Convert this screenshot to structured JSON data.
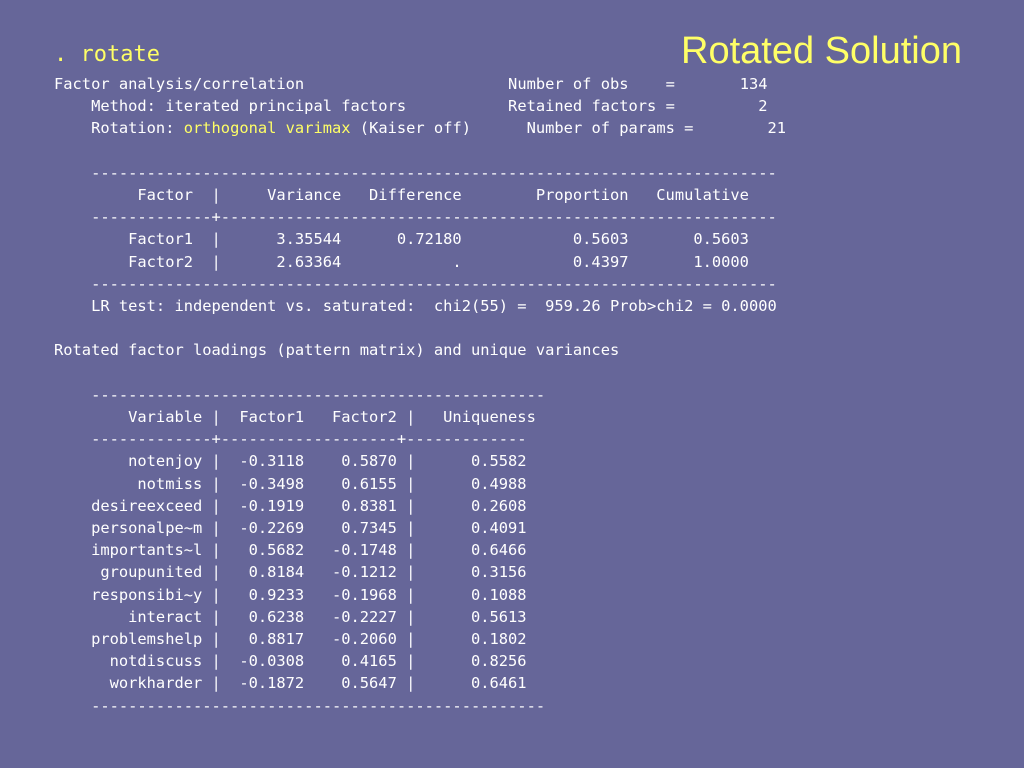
{
  "slide": {
    "title": "Rotated Solution",
    "command": ". rotate"
  },
  "colors": {
    "background": "#666699",
    "text": "#ffffff",
    "highlight": "#ffff66"
  },
  "header": {
    "analysis_line": "Factor analysis/correlation",
    "method_line": "    Method: iterated principal factors",
    "rotation_prefix": "    Rotation: ",
    "rotation_value": "orthogonal varimax",
    "rotation_suffix": " (Kaiser off)",
    "stat1": "Number of obs    =       134",
    "stat2": "Retained factors =         2",
    "stat3": "Number of params =        21"
  },
  "variance_table": {
    "rule": "    --------------------------------------------------------------------------",
    "header": "         Factor  |     Variance   Difference        Proportion   Cumulative",
    "divider": "    -------------+------------------------------------------------------------",
    "rows": [
      "        Factor1  |      3.35544      0.72180            0.5603       0.5603",
      "        Factor2  |      2.63364            .            0.4397       1.0000"
    ],
    "lr_test": "    LR test: independent vs. saturated:  chi2(55) =  959.26 Prob>chi2 = 0.0000"
  },
  "loadings": {
    "caption": "Rotated factor loadings (pattern matrix) and unique variances",
    "rule": "    -------------------------------------------------",
    "header": "        Variable |  Factor1   Factor2 |   Uniqueness",
    "divider": "    -------------+-------------------+-------------",
    "rows": [
      "        notenjoy |  -0.3118    0.5870 |      0.5582",
      "         notmiss |  -0.3498    0.6155 |      0.4988",
      "    desireexceed |  -0.1919    0.8381 |      0.2608",
      "    personalpe~m |  -0.2269    0.7345 |      0.4091",
      "    importants~l |   0.5682   -0.1748 |      0.6466",
      "     groupunited |   0.8184   -0.1212 |      0.3156",
      "    responsibi~y |   0.9233   -0.1968 |      0.1088",
      "        interact |   0.6238   -0.2227 |      0.5613",
      "    problemshelp |   0.8817   -0.2060 |      0.1802",
      "      notdiscuss |  -0.0308    0.4165 |      0.8256",
      "      workharder |  -0.1872    0.5647 |      0.6461"
    ]
  }
}
